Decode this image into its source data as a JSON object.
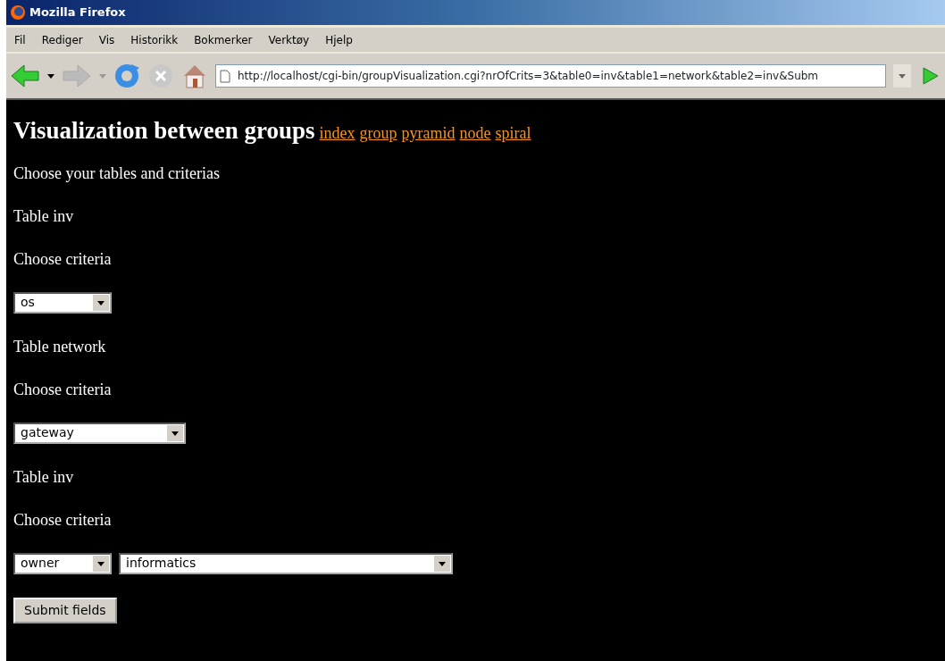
{
  "window": {
    "title": "Mozilla Firefox"
  },
  "menu": [
    "Fil",
    "Rediger",
    "Vis",
    "Historikk",
    "Bokmerker",
    "Verktøy",
    "Hjelp"
  ],
  "toolbar": {
    "back_disabled": false,
    "forward_disabled": true,
    "stop_disabled": true,
    "address": "http://localhost/cgi-bin/groupVisualization.cgi?nrOfCrits=3&table0=inv&table1=network&table2=inv&Subm"
  },
  "page": {
    "heading": "Visualization between groups",
    "links": [
      "index",
      "group",
      "pyramid",
      "node",
      "spiral"
    ],
    "intro": "Choose your tables and criterias",
    "tables": [
      {
        "label": "Table inv",
        "criteria_label": "Choose criteria",
        "selects": [
          {
            "value": "os"
          }
        ]
      },
      {
        "label": "Table network",
        "criteria_label": "Choose criteria",
        "selects": [
          {
            "value": "gateway"
          }
        ]
      },
      {
        "label": "Table inv",
        "criteria_label": "Choose criteria",
        "selects": [
          {
            "value": "owner"
          },
          {
            "value": "informatics"
          }
        ]
      }
    ],
    "submit": "Submit fields"
  }
}
